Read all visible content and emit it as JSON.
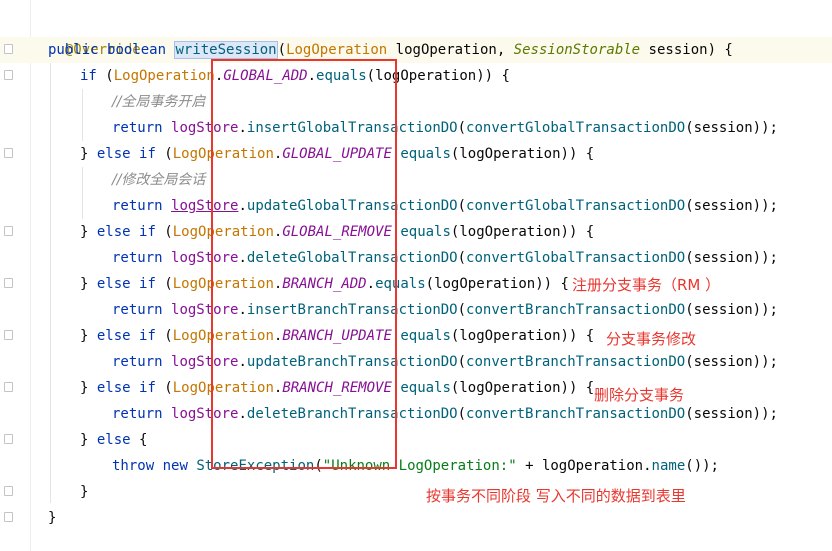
{
  "code": {
    "annotation": "@Override",
    "kw_public": "public",
    "kw_boolean": "boolean",
    "method_name": "writeSession",
    "param_type1": "LogOperation",
    "param_name1": "logOperation",
    "param_type2": "SessionStorable",
    "param_name2": "session",
    "kw_if": "if",
    "kw_else": "else",
    "kw_return": "return",
    "kw_throw": "throw",
    "kw_new": "new",
    "class_logop": "LogOperation",
    "field_global_add": "GLOBAL_ADD",
    "field_global_update": "GLOBAL_UPDATE",
    "field_global_remove": "GLOBAL_REMOVE",
    "field_branch_add": "BRANCH_ADD",
    "field_branch_update": "BRANCH_UPDATE",
    "field_branch_remove": "BRANCH_REMOVE",
    "equals": "equals",
    "var_logop": "logOperation",
    "store": "logStore",
    "insert_global": "insertGlobalTransactionDO",
    "update_global": "updateGlobalTransactionDO",
    "delete_global": "deleteGlobalTransactionDO",
    "insert_branch": "insertBranchTransactionDO",
    "update_branch": "updateBranchTransactionDO",
    "delete_branch": "deleteBranchTransactionDO",
    "convert_global": "convertGlobalTransactionDO",
    "convert_branch": "convertBranchTransactionDO",
    "var_session": "session",
    "comment_global_start": "//全局事务开启",
    "comment_global_modify": "//修改全局会话",
    "exception_class": "StoreException",
    "exception_msg": "\"Unknown LogOperation:\"",
    "name_call": "name"
  },
  "notes": {
    "register_branch": "注册分支事务（RM ）",
    "modify_branch": "分支事务修改",
    "delete_branch": "删除分支事务",
    "summary": "按事务不同阶段 写入不同的数据到表里"
  },
  "colors": {
    "keyword": "#0033b3",
    "annotation": "#9e880d",
    "class": "#c47600",
    "method": "#00627a",
    "field": "#871094",
    "string": "#067d17",
    "red_note": "#e8372f"
  }
}
